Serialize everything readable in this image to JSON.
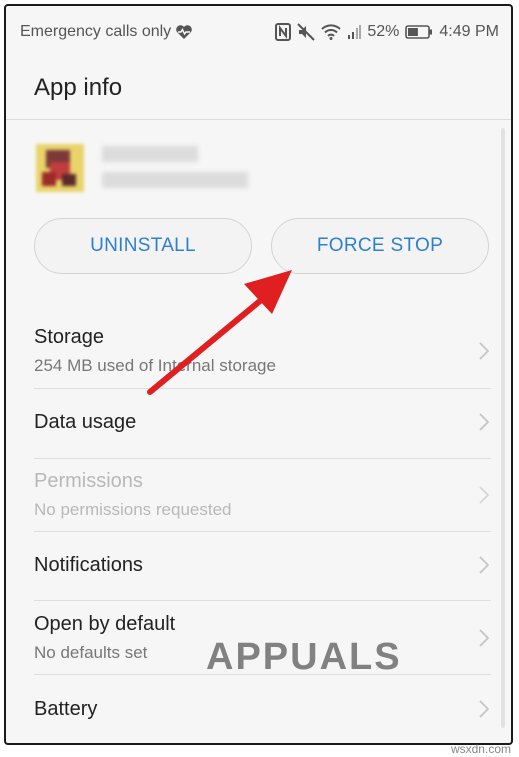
{
  "status_bar": {
    "carrier_text": "Emergency calls only",
    "battery_percent": "52%",
    "time": "4:49 PM",
    "battery_level": 0.52
  },
  "header": {
    "title": "App info"
  },
  "actions": {
    "uninstall_label": "UNINSTALL",
    "force_stop_label": "FORCE STOP"
  },
  "list": {
    "storage": {
      "title": "Storage",
      "subtitle": "254 MB used of Internal storage"
    },
    "data_usage": {
      "title": "Data usage"
    },
    "permissions": {
      "title": "Permissions",
      "subtitle": "No permissions requested"
    },
    "notifications": {
      "title": "Notifications"
    },
    "open_by_default": {
      "title": "Open by default",
      "subtitle": "No defaults set"
    },
    "battery": {
      "title": "Battery"
    }
  },
  "watermark": "APPUALS",
  "footer": "wsxdn.com",
  "colors": {
    "accent": "#2f7fd0",
    "arrow": "#e02020"
  },
  "icons": [
    "heart-pulse-icon",
    "nfc-icon",
    "mute-icon",
    "wifi-icon",
    "signal-icon",
    "battery-icon",
    "chevron-right-icon"
  ]
}
